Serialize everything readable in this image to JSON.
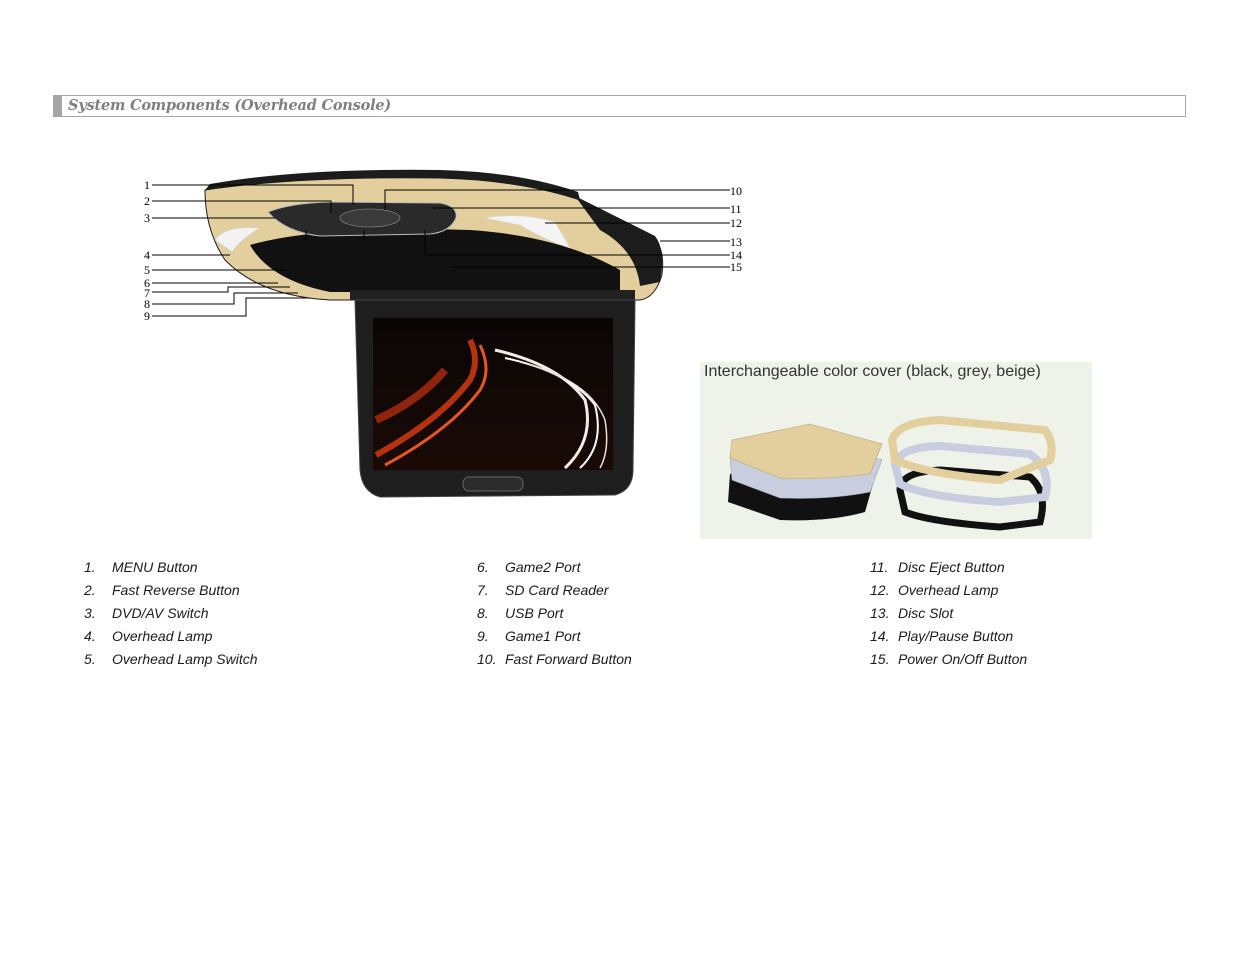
{
  "section": {
    "title": "System Components (Overhead Console)"
  },
  "figure": {
    "callouts": [
      "1",
      "2",
      "3",
      "4",
      "5",
      "6",
      "7",
      "8",
      "9",
      "10",
      "11",
      "12",
      "13",
      "14",
      "15"
    ],
    "cover_caption": "Interchangeable color cover (black, grey, beige)",
    "colors": {
      "beige": "#e3cf9e",
      "dark": "#1c1c1c",
      "grey_cover": "#c9cde0",
      "panel_bg": "#eef2e8"
    }
  },
  "components": [
    {
      "num": "1.",
      "label": "MENU Button"
    },
    {
      "num": "2.",
      "label": "Fast Reverse Button"
    },
    {
      "num": "3.",
      "label": "DVD/AV Switch"
    },
    {
      "num": "4.",
      "label": "Overhead Lamp"
    },
    {
      "num": "5.",
      "label": "Overhead Lamp Switch"
    },
    {
      "num": "6.",
      "label": "Game2 Port"
    },
    {
      "num": "7.",
      "label": "SD Card Reader"
    },
    {
      "num": "8.",
      "label": "USB Port"
    },
    {
      "num": "9.",
      "label": "Game1 Port"
    },
    {
      "num": "10.",
      "label": "Fast Forward Button"
    },
    {
      "num": "11.",
      "label": "Disc Eject Button"
    },
    {
      "num": "12.",
      "label": "Overhead Lamp"
    },
    {
      "num": "13.",
      "label": "Disc Slot"
    },
    {
      "num": "14.",
      "label": "Play/Pause Button"
    },
    {
      "num": "15.",
      "label": "Power On/Off Button"
    }
  ]
}
